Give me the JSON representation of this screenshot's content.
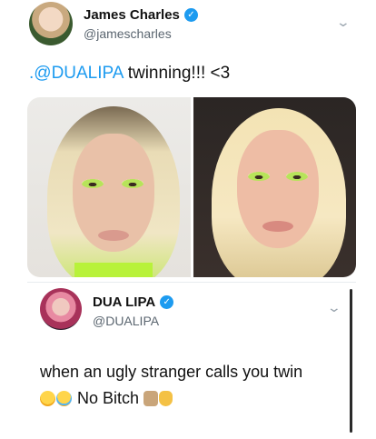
{
  "original_tweet": {
    "display_name": "James Charles",
    "handle": "@jamescharles",
    "text_mention": ".@DUALIPA",
    "text_rest": " twinning!!! <3",
    "verified_glyph": "✓",
    "menu_icon": "chevron-down-icon",
    "media_icons": [
      "person-photo-left",
      "person-photo-right"
    ]
  },
  "reply_tweet": {
    "display_name": "DUA LIPA",
    "handle": "@DUALIPA",
    "verified_glyph": "✓",
    "menu_icon": "chevron-down-icon",
    "line1": "when an ugly stranger calls you twin",
    "line2_text": " No Bitch ",
    "line2_emojis_before": [
      "face-with-tears-of-joy",
      "loudly-crying-face"
    ],
    "line2_emojis_after": [
      "person-gesturing-no",
      "raised-hand"
    ]
  },
  "colors": {
    "accent": "#1d9bf0",
    "secondary_text": "#5b6670",
    "neon_green": "#b8f23a"
  }
}
